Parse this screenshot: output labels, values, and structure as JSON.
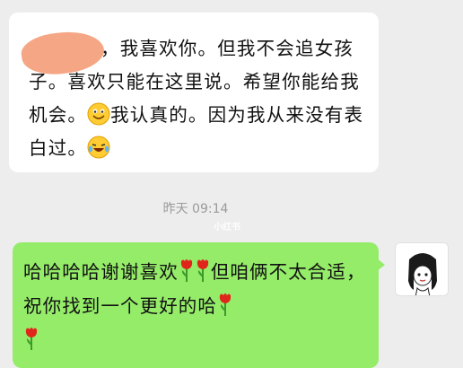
{
  "messages": [
    {
      "sender": "other",
      "text_after_redaction": "，我喜欢你。但我不会追女孩子。喜欢只能在这里说。希望你能给我机会。",
      "text_tail_1": "我认真的。因为我从来没有表白过。",
      "emoji_1": "smiling-face-icon",
      "emoji_2": "laughing-tears-face-icon"
    },
    {
      "sender": "me",
      "text_1": "哈哈哈哈谢谢喜欢",
      "text_2": "但咱俩不太合适，祝你找到一个更好的哈",
      "emoji": "rose-icon"
    }
  ],
  "timestamp": "昨天 09:14",
  "watermark": "小红书",
  "colors": {
    "background": "#ededed",
    "incoming_bubble": "#ffffff",
    "outgoing_bubble": "#95ec69",
    "redaction": "#f4a27e"
  }
}
